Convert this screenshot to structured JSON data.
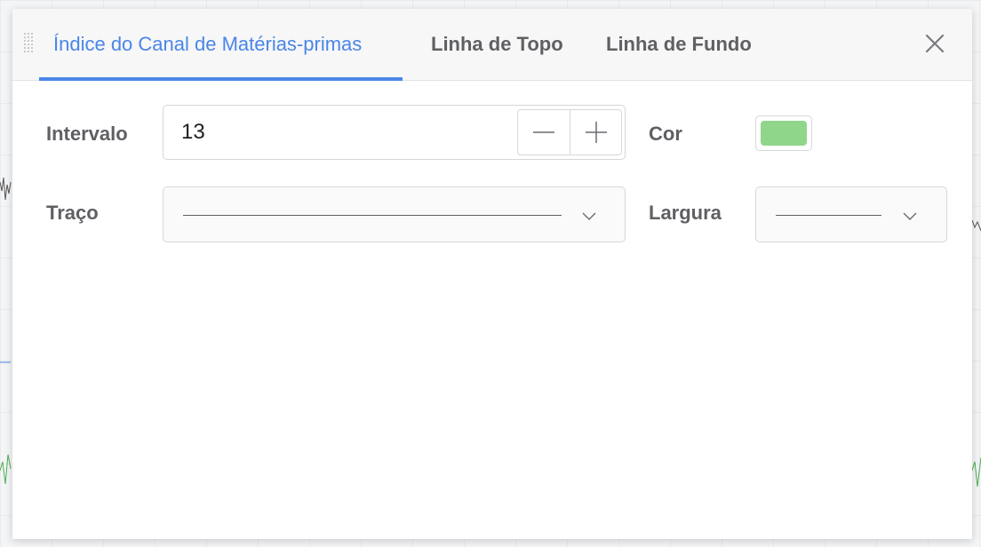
{
  "tabs": [
    {
      "label": "Índice do Canal de Matérias-primas",
      "active": true
    },
    {
      "label": "Linha de Topo",
      "active": false
    },
    {
      "label": "Linha de Fundo",
      "active": false
    }
  ],
  "form": {
    "interval_label": "Intervalo",
    "interval_value": "13",
    "color_label": "Cor",
    "color_value": "#8fd68a",
    "stroke_label": "Traço",
    "width_label": "Largura"
  },
  "icons": {
    "drag": "drag-handle-icon",
    "close": "close-icon",
    "minus": "minus-icon",
    "plus": "plus-icon",
    "chevron": "chevron-down-icon"
  },
  "colors": {
    "accent": "#4a86e8",
    "text": "#5f6064",
    "border": "#d6d7da"
  }
}
